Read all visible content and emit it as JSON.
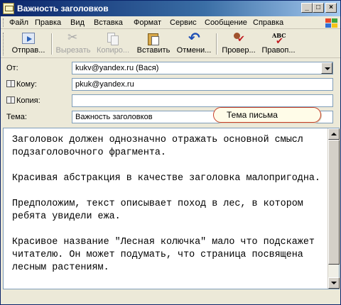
{
  "window": {
    "title": "Важность заголовков"
  },
  "menu": [
    {
      "label": "Файл"
    },
    {
      "label": "Правка"
    },
    {
      "label": "Вид"
    },
    {
      "label": "Вставка"
    },
    {
      "label": "Формат"
    },
    {
      "label": "Сервис"
    },
    {
      "label": "Сообщение"
    },
    {
      "label": "Справка"
    }
  ],
  "toolbar": {
    "send": "Отправ...",
    "cut": "Вырезать",
    "copy": "Копиро...",
    "paste": "Вставить",
    "undo": "Отмени...",
    "check": "Провер...",
    "spell": "Правоп...",
    "spell_icon_text": "ABC"
  },
  "fields": {
    "from_label": "От:",
    "from_value": "kukv@yandex.ru     (Вася)",
    "to_label": "Кому:",
    "to_value": "pkuk@yandex.ru",
    "cc_label": "Копия:",
    "cc_value": "",
    "subject_label": "Тема:",
    "subject_value": "Важность заголовков"
  },
  "callout": "Тема письма",
  "body": [
    "Заголовок должен однозначно отражать основной смысл подзаголовочного фрагмента.",
    "Красивая абстракция в качестве заголовка малопригодна.",
    "Предположим, текст описывает поход в лес, в котором ребята увидели ежа.",
    "Красивое название \"Лесная колючка\" мало что подскажет читателю. Он может подумать, что страница посвящена лесным растениям."
  ]
}
